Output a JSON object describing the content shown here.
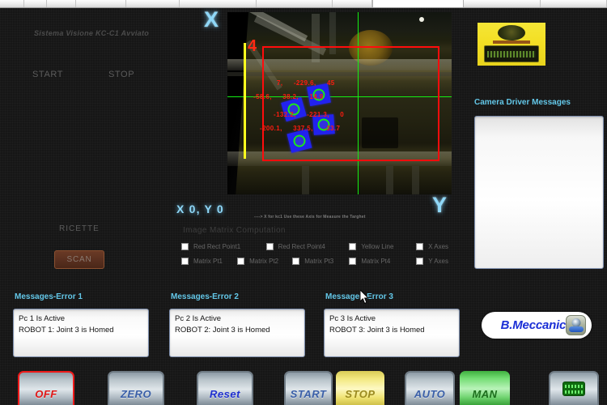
{
  "window": {
    "system_status": "Sistema Visione KC-C1 Avviato",
    "start_label": "START",
    "stop_label": "STOP"
  },
  "axes": {
    "x_letter": "X",
    "y_letter": "Y",
    "readout": "X 0, Y 0",
    "note": "----> X for kc1 Use these  Axis for Measure the Targhet"
  },
  "camera": {
    "yellow_marker_number": "4",
    "detections": [
      {
        "x": "7",
        "y": "-229.6",
        "angle": "45"
      },
      {
        "x": "-58.6",
        "y": "38.2",
        "angle": "14.9"
      },
      {
        "x": "-132.2",
        "y": "-221.3",
        "angle": "0"
      },
      {
        "x": "-200.1",
        "y": "337.5",
        "angle": "-33.7"
      }
    ],
    "colors": {
      "roi_rect": "#ff0c0c",
      "crosshair": "#14f014",
      "reference_line": "#ffff1e",
      "part_fill": "#2222ee",
      "part_ring": "#19e819",
      "coord_text": "#ff1b10"
    }
  },
  "matrix": {
    "title": "Image Matrix Computation",
    "row1": [
      {
        "label": "Red Rect Point1",
        "checked": false
      },
      {
        "label": "Red Rect Point4",
        "checked": false
      },
      {
        "label": "Yellow Line",
        "checked": false
      },
      {
        "label": "X Axes",
        "checked": false
      }
    ],
    "row2": [
      {
        "label": "Matrix Pt1",
        "checked": false
      },
      {
        "label": "Matrix Pt2",
        "checked": false
      },
      {
        "label": "Matrix Pt3",
        "checked": false
      },
      {
        "label": "Matrix Pt4",
        "checked": false
      },
      {
        "label": "Y Axes",
        "checked": false
      }
    ]
  },
  "camera_driver": {
    "title": "Camera Driver Messages",
    "content": ""
  },
  "recipes": {
    "label": "RICETTE",
    "scan_label": "SCAN"
  },
  "messages": [
    {
      "title": "Messages-Error 1",
      "line1": "Pc 1 Is Active",
      "line2": "ROBOT 1: Joint 3 is Homed"
    },
    {
      "title": "Messages-Error 2",
      "line1": "Pc 2 Is Active",
      "line2": "ROBOT 2: Joint 3 is Homed"
    },
    {
      "title": "Messages-Error 3",
      "line1": "Pc 3 Is Active",
      "line2": "ROBOT 3: Joint 3 is Homed"
    }
  ],
  "brand": {
    "name": "B.Meccanica",
    "color": "#1b2fd6"
  },
  "bottom_buttons": [
    {
      "id": "off",
      "label": "OFF",
      "accent": "#ee1a1a"
    },
    {
      "id": "zero",
      "label": "ZERO",
      "accent": "#6f7b85"
    },
    {
      "id": "reset",
      "label": "Reset",
      "accent": "#1f2fd0"
    },
    {
      "id": "start",
      "label": "START",
      "accent": "#6f7b85"
    },
    {
      "id": "stop",
      "label": "STOP",
      "accent": "#d9a51b"
    },
    {
      "id": "auto",
      "label": "AUTO",
      "accent": "#6f7b85"
    },
    {
      "id": "man",
      "label": "MAN",
      "accent": "#25a025"
    },
    {
      "id": "keyboard",
      "label": "",
      "accent": "#0f6b0f"
    }
  ]
}
